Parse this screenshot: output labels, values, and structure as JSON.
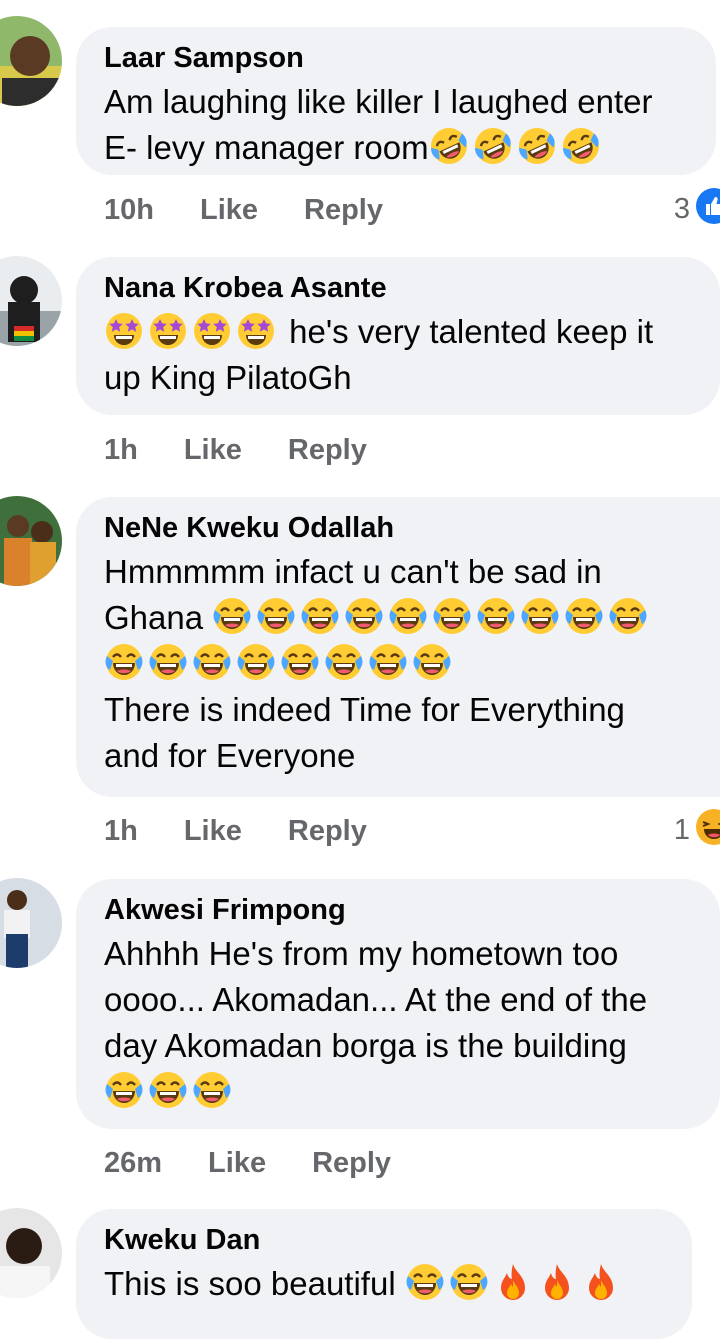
{
  "comments": [
    {
      "author": "Laar Sampson",
      "lines": [
        "Am laughing like killer I laughed enter",
        "E- levy manager room"
      ],
      "time": "10h",
      "like_label": "Like",
      "reply_label": "Reply",
      "reaction_count": "3",
      "reaction_icon": "like-icon"
    },
    {
      "author": "Nana Krobea Asante",
      "lines": [
        " he's very talented keep it",
        "up King PilatoGh"
      ],
      "time": "1h",
      "like_label": "Like",
      "reply_label": "Reply"
    },
    {
      "author": "NeNe Kweku Odallah",
      "lines": [
        "Hmmmmm infact u can't be sad in",
        "Ghana ",
        "There is indeed Time for Everything",
        "and for Everyone"
      ],
      "time": "1h",
      "like_label": "Like",
      "reply_label": "Reply",
      "reaction_count": "1",
      "reaction_icon": "haha-icon"
    },
    {
      "author": "Akwesi Frimpong",
      "lines": [
        "Ahhhh He's from my hometown too",
        "oooo... Akomadan... At the end of the",
        "day Akomadan borga is the building"
      ],
      "time": "26m",
      "like_label": "Like",
      "reply_label": "Reply"
    },
    {
      "author": "Kweku Dan",
      "lines": [
        "This is soo beautiful "
      ]
    }
  ],
  "colors": {
    "bubble": "#f0f2f5",
    "meta_text": "#65676b",
    "like_blue": "#1877f2"
  }
}
